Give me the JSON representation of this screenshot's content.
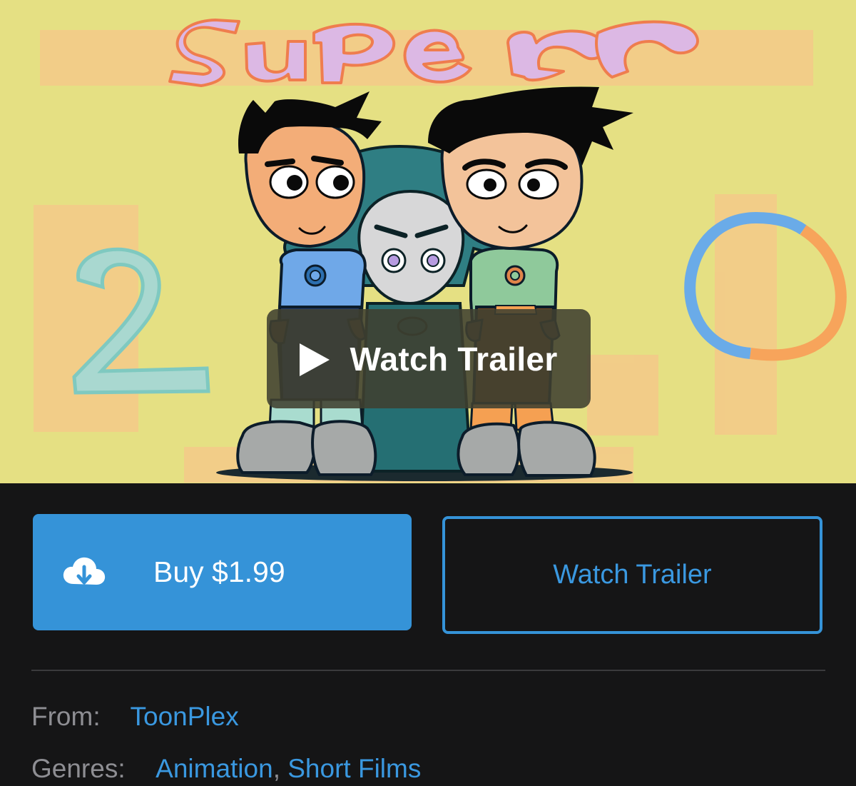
{
  "hero": {
    "art_title_text": "Super",
    "art_numerals": "2 0",
    "overlay_label": "Watch Trailer",
    "background_color": "#e5e083",
    "icon": "play-icon"
  },
  "actions": {
    "buy_label": "Buy $1.99",
    "buy_icon": "cloud-download-icon",
    "buy_color": "#3593d8",
    "trailer_label": "Watch Trailer"
  },
  "details": {
    "from_label": "From:",
    "from_value": "ToonPlex",
    "genres_label": "Genres:",
    "genres": [
      "Animation",
      "Short Films"
    ],
    "genre_separator": ","
  },
  "colors": {
    "page_background": "#151516",
    "accent": "#3a98e0",
    "secondary_text": "#8e8e93"
  }
}
